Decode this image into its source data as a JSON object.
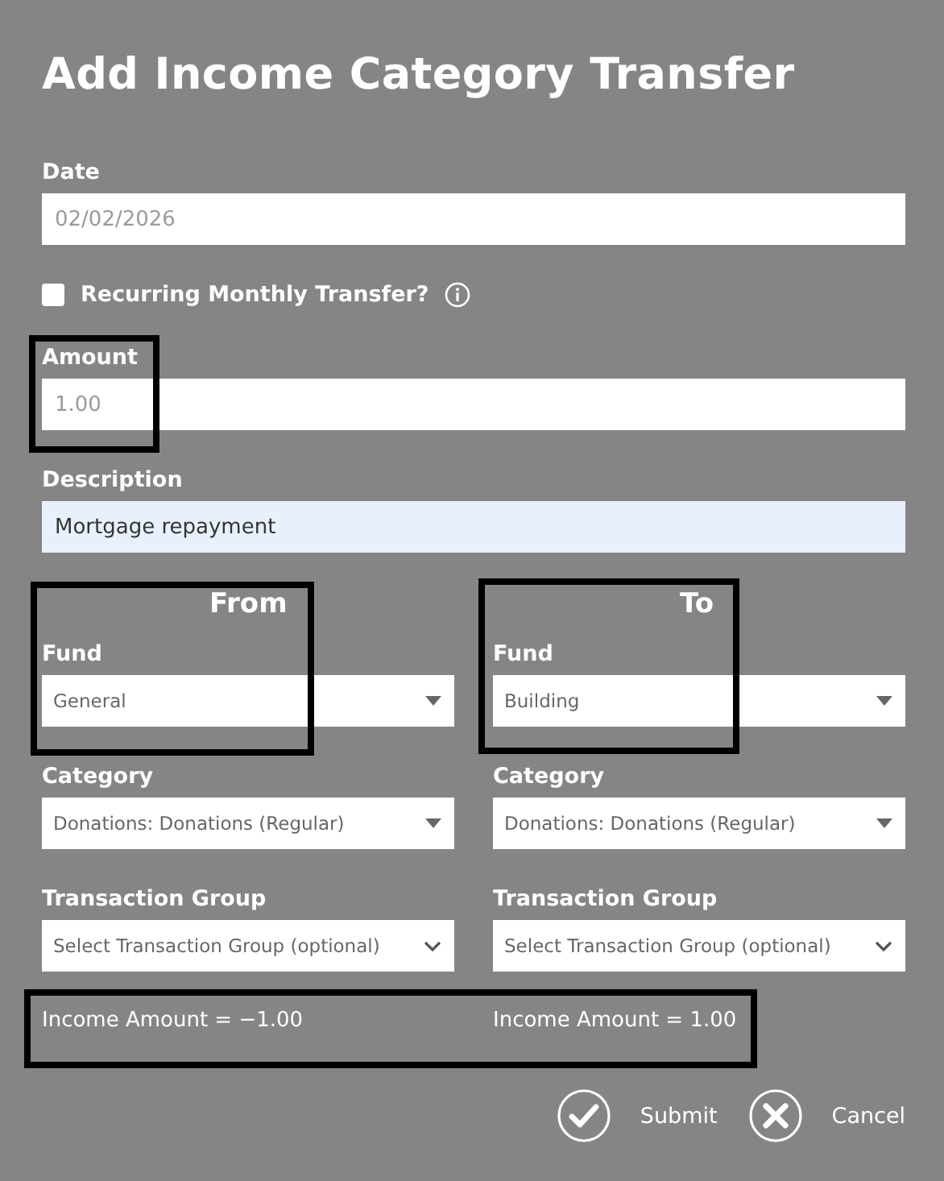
{
  "title": "Add Income Category Transfer",
  "date": {
    "label": "Date",
    "placeholder": "02/02/2026"
  },
  "recurring": {
    "label": "Recurring Monthly Transfer?",
    "checked": false
  },
  "amount": {
    "label": "Amount",
    "placeholder": "1.00"
  },
  "description": {
    "label": "Description",
    "value": "Mortgage repayment"
  },
  "columns": [
    {
      "heading": "From",
      "fund": {
        "label": "Fund",
        "value": "General"
      },
      "category": {
        "label": "Category",
        "value": "Donations: Donations (Regular)"
      },
      "group": {
        "label": "Transaction Group",
        "placeholder": "Select Transaction Group (optional)"
      },
      "income": "Income Amount = −1.00"
    },
    {
      "heading": "To",
      "fund": {
        "label": "Fund",
        "value": "Building"
      },
      "category": {
        "label": "Category",
        "value": "Donations: Donations (Regular)"
      },
      "group": {
        "label": "Transaction Group",
        "placeholder": "Select Transaction Group (optional)"
      },
      "income": "Income Amount = 1.00"
    }
  ],
  "buttons": [
    {
      "kind": "submit",
      "label": "Submit"
    },
    {
      "kind": "cancel",
      "label": "Cancel"
    }
  ]
}
